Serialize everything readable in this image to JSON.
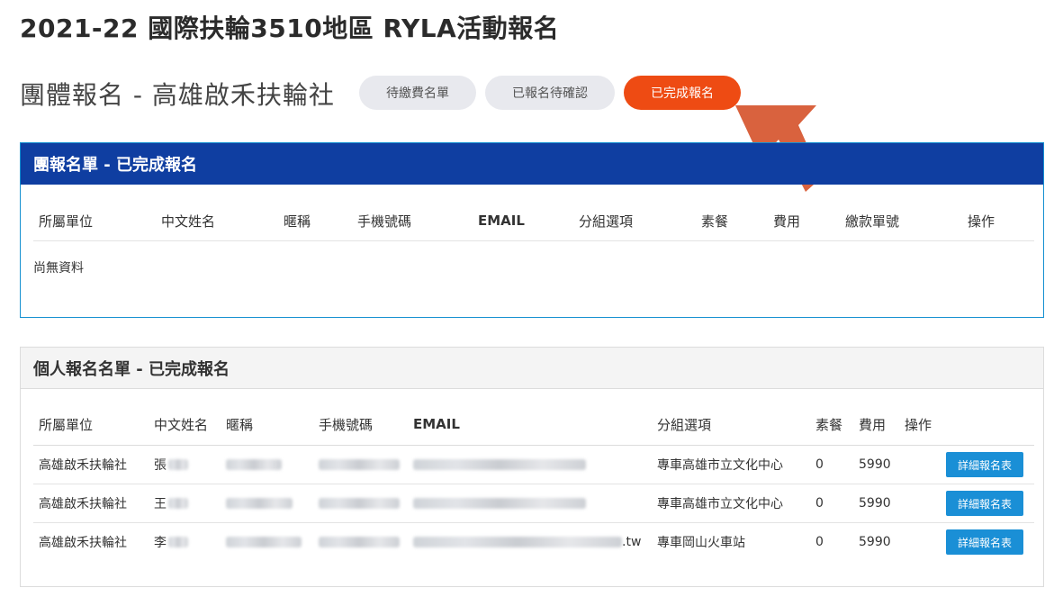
{
  "page_title": "2021-22 國際扶輪3510地區 RYLA活動報名",
  "subheader": {
    "title": "團體報名 - 高雄啟禾扶輪社",
    "tabs": [
      {
        "label": "待繳費名單",
        "active": false
      },
      {
        "label": "已報名待確認",
        "active": false
      },
      {
        "label": "已完成報名",
        "active": true
      }
    ]
  },
  "colors": {
    "accent_active": "#ee4b13",
    "group_header": "#0f3ea1",
    "button": "#1a8fd6",
    "arrow": "#d9623e"
  },
  "group_panel": {
    "title": "團報名單 - 已完成報名",
    "columns": [
      "所屬單位",
      "中文姓名",
      "暱稱",
      "手機號碼",
      "EMAIL",
      "分組選項",
      "素餐",
      "費用",
      "繳款單號",
      "操作"
    ],
    "empty_text": "尚無資料"
  },
  "individual_panel": {
    "title": "個人報名名單 - 已完成報名",
    "columns": [
      "所屬單位",
      "中文姓名",
      "暱稱",
      "手機號碼",
      "EMAIL",
      "分組選項",
      "素餐",
      "費用",
      "操作"
    ],
    "rows": [
      {
        "unit": "高雄啟禾扶輪社",
        "name": "張",
        "group": "專車高雄市立文化中心",
        "vegetarian": "0",
        "fee": "5990",
        "action": "詳細報名表"
      },
      {
        "unit": "高雄啟禾扶輪社",
        "name": "王",
        "group": "專車高雄市立文化中心",
        "vegetarian": "0",
        "fee": "5990",
        "action": "詳細報名表"
      },
      {
        "unit": "高雄啟禾扶輪社",
        "name": "李",
        "email_suffix": ".tw",
        "group": "專車岡山火車站",
        "vegetarian": "0",
        "fee": "5990",
        "action": "詳細報名表"
      }
    ]
  }
}
